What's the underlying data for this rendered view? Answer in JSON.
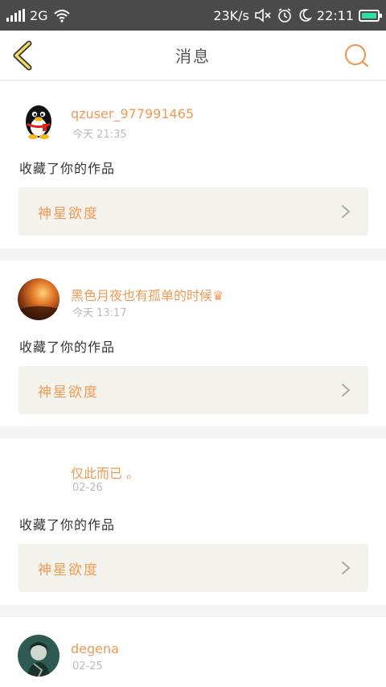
{
  "status": {
    "network": "2G",
    "speed": "23K/s",
    "time": "22:11",
    "battery_color": "#2fe0a0"
  },
  "header": {
    "title": "消息",
    "back_icon": "chevron-left-icon",
    "search_icon": "search-icon",
    "accent": "#ef9a55"
  },
  "messages": [
    {
      "user": "qzuser_977991465",
      "time": "今天 21:35",
      "action": "收藏了你的作品",
      "work": "神星欲度",
      "avatar": "qq-penguin-avatar"
    },
    {
      "user": "黑色月夜也有孤单的时候♛",
      "time": "今天 13:17",
      "action": "收藏了你的作品",
      "work": "神星欲度",
      "avatar": "sunset-avatar"
    },
    {
      "user": "仅此而已 。",
      "time": "02-26",
      "action": "收藏了你的作品",
      "work": "神星欲度",
      "avatar": "blank-avatar"
    },
    {
      "user": "degena",
      "time": "02-25",
      "avatar": "character-avatar"
    }
  ]
}
